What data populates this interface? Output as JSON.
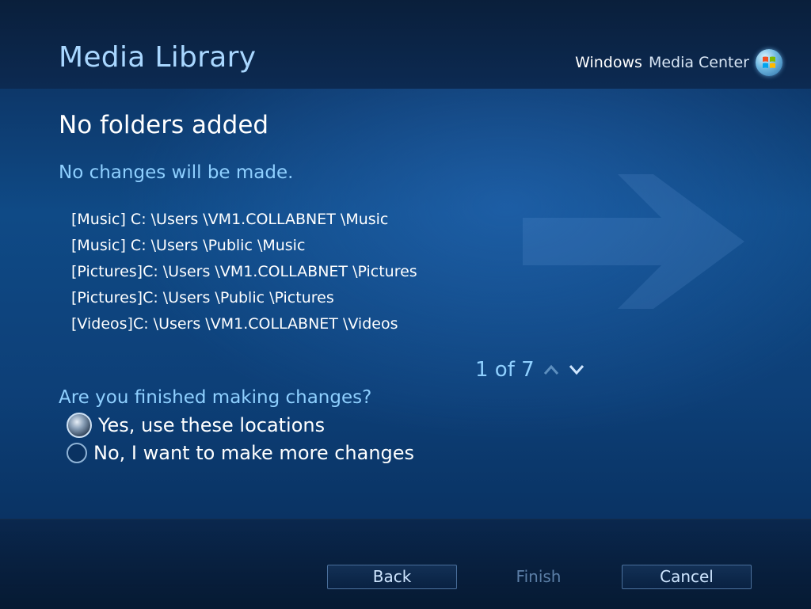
{
  "header": {
    "title": "Media Library",
    "brand_windows": "Windows",
    "brand_media_center": "Media Center"
  },
  "main": {
    "heading": "No folders added",
    "subheading": "No changes will be made.",
    "folders": [
      "[Music] C: \\Users \\VM1.COLLABNET \\Music",
      "[Music] C: \\Users \\Public \\Music",
      "[Pictures]C: \\Users \\VM1.COLLABNET \\Pictures",
      "[Pictures]C: \\Users \\Public \\Pictures",
      "[Videos]C: \\Users \\VM1.COLLABNET \\Videos"
    ],
    "pager": {
      "text": "1 of 7"
    },
    "question": "Are you finished making changes?",
    "options": [
      {
        "label": "Yes, use these locations",
        "selected": true
      },
      {
        "label": "No, I want to make more changes",
        "selected": false
      }
    ]
  },
  "footer": {
    "back_label": "Back",
    "finish_label": "Finish",
    "cancel_label": "Cancel"
  },
  "colors": {
    "accent": "#8fd0ff",
    "title": "#a9d7ff",
    "disabled": "#5b7ea6"
  },
  "icons": [
    "windows-logo-icon",
    "background-arrow-icon",
    "page-up-icon",
    "page-down-icon",
    "radio-selected-icon",
    "radio-unselected-icon"
  ]
}
